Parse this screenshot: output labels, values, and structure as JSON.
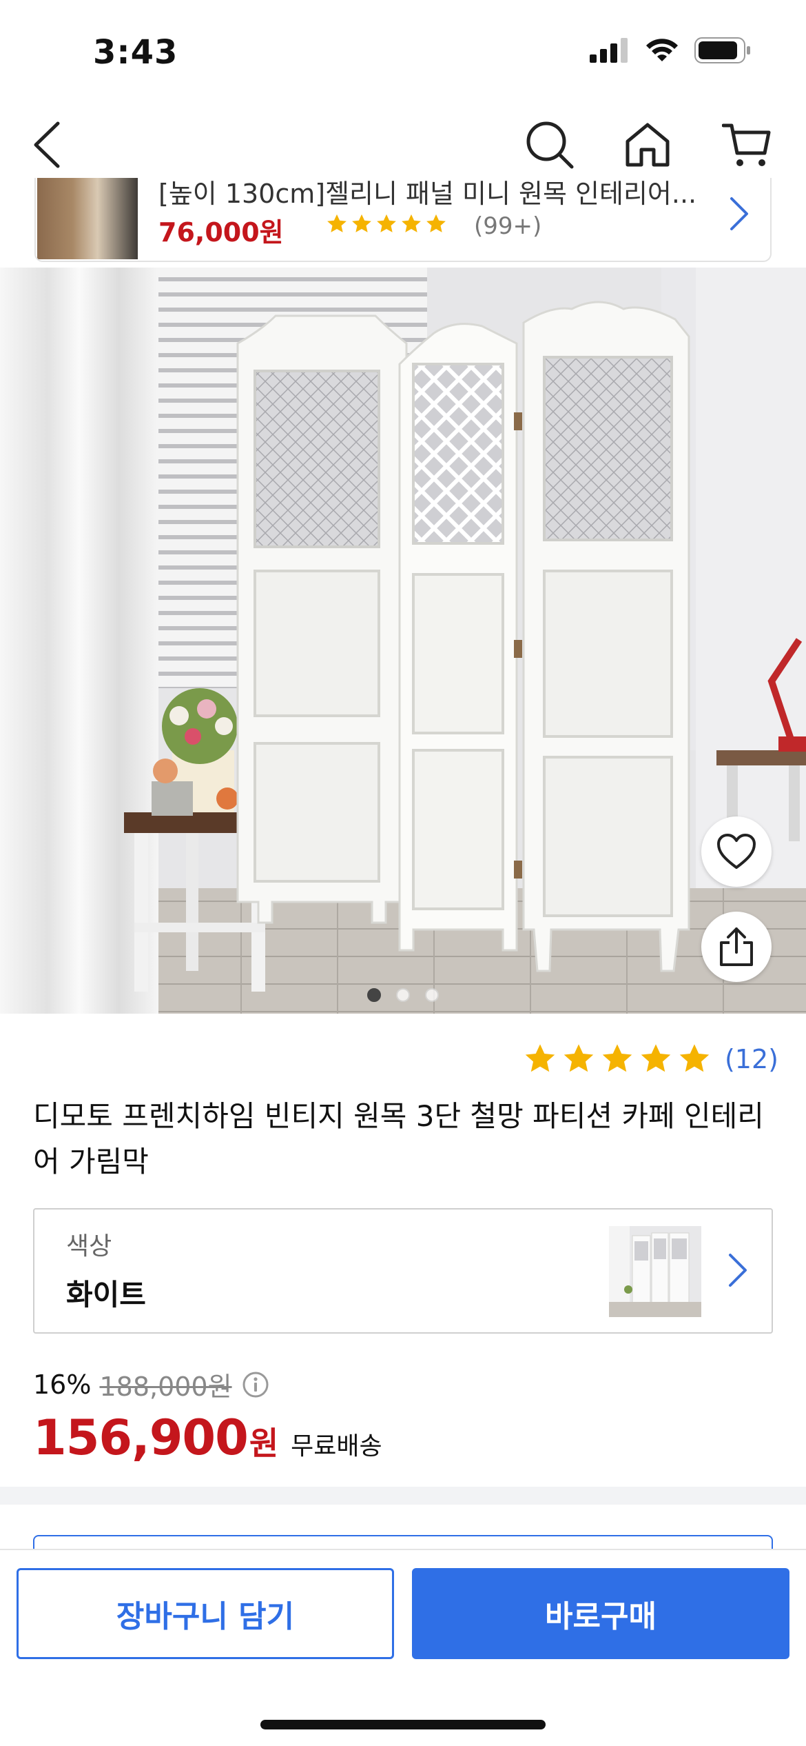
{
  "status_bar": {
    "time": "3:43",
    "icons": [
      "cellular-signal-icon",
      "wifi-icon",
      "battery-icon"
    ]
  },
  "nav": {
    "icons": [
      "back-chevron-icon",
      "search-icon",
      "home-icon",
      "cart-icon"
    ]
  },
  "mini_card": {
    "title": "[높이 130cm]젤리니 패널 미니 원목 인테리어...",
    "price": "76,000원",
    "rating_stars": 5,
    "review_count": "(99+)"
  },
  "hero": {
    "image_description_icon": "room-divider-photo",
    "slide_count": 3,
    "active_slide": 1
  },
  "product": {
    "rating_stars": 5,
    "review_count": "(12)",
    "title": "디모토 프렌치하임 빈티지 원목 3단 철망 파티션 카페 인테리어 가림막"
  },
  "option": {
    "label": "색상",
    "value": "화이트"
  },
  "price": {
    "discount": "16%",
    "original": "188,000원",
    "sale_amount": "156,900",
    "sale_unit": "원",
    "shipping": "무료배송"
  },
  "bottom_bar": {
    "cart_label": "장바구니 담기",
    "buy_label": "바로구매"
  },
  "colors": {
    "accent_blue": "#2f6fe6",
    "price_red": "#c4161c",
    "star_yellow": "#f5b301"
  }
}
